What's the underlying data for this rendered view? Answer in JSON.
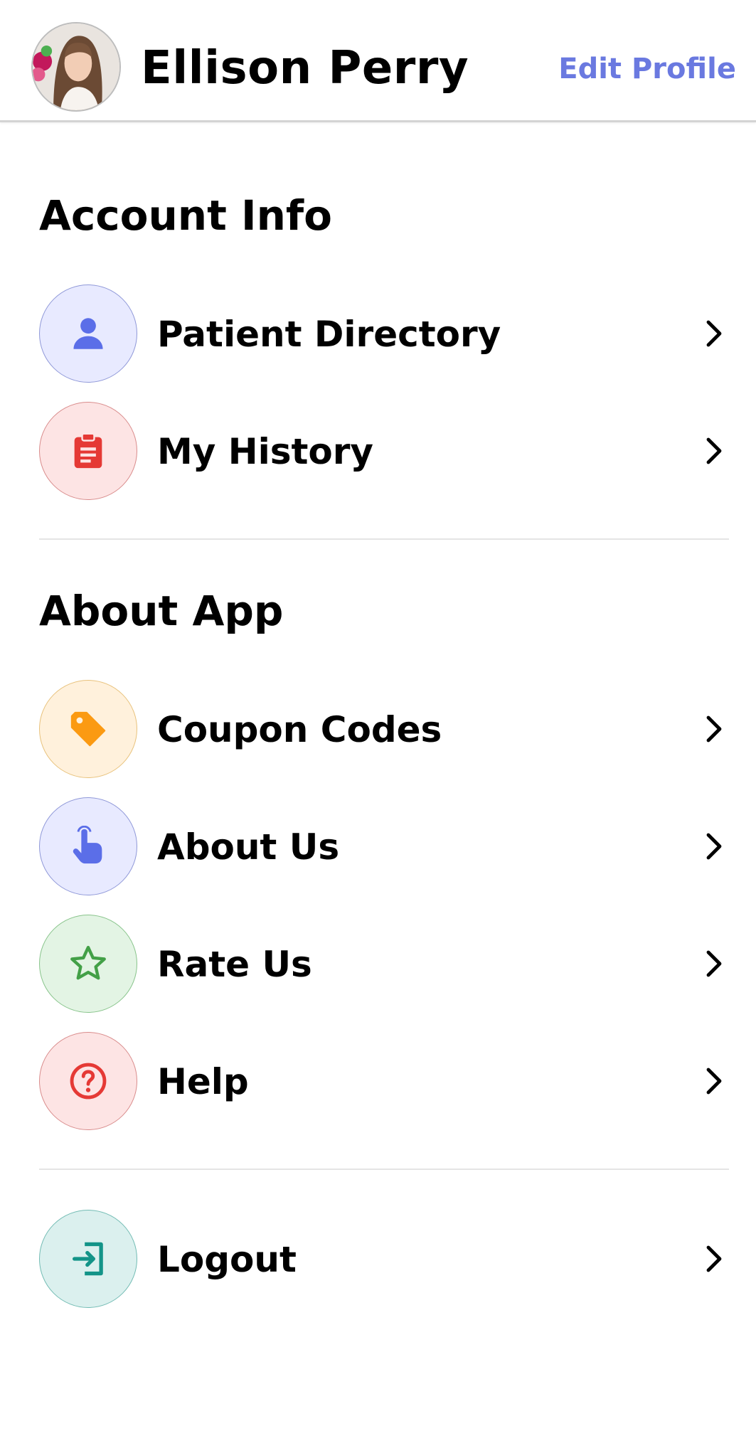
{
  "header": {
    "user_name": "Ellison Perry",
    "edit_label": "Edit Profile",
    "accent_color": "#6a79e0"
  },
  "sections": [
    {
      "title": "Account Info",
      "items": [
        {
          "label": "Patient Directory",
          "icon": "person-icon",
          "icon_color": "#5b6ee8",
          "bg_color": "#e8eaff"
        },
        {
          "label": "My History",
          "icon": "clipboard-icon",
          "icon_color": "#e53935",
          "bg_color": "#fde4e4"
        }
      ]
    },
    {
      "title": "About App",
      "items": [
        {
          "label": "Coupon Codes",
          "icon": "tag-icon",
          "icon_color": "#fb9a12",
          "bg_color": "#fff1dc"
        },
        {
          "label": "About Us",
          "icon": "pointing-hand-icon",
          "icon_color": "#5b6ee8",
          "bg_color": "#e8eaff"
        },
        {
          "label": "Rate Us",
          "icon": "star-icon",
          "icon_color": "#43a047",
          "bg_color": "#e3f4e4"
        },
        {
          "label": "Help",
          "icon": "question-circle-icon",
          "icon_color": "#e53935",
          "bg_color": "#fde4e4"
        }
      ]
    }
  ],
  "logout": {
    "label": "Logout",
    "icon": "logout-icon",
    "icon_color": "#139488",
    "bg_color": "#dbf0ee"
  },
  "chevron_icon": "chevron-right-icon"
}
